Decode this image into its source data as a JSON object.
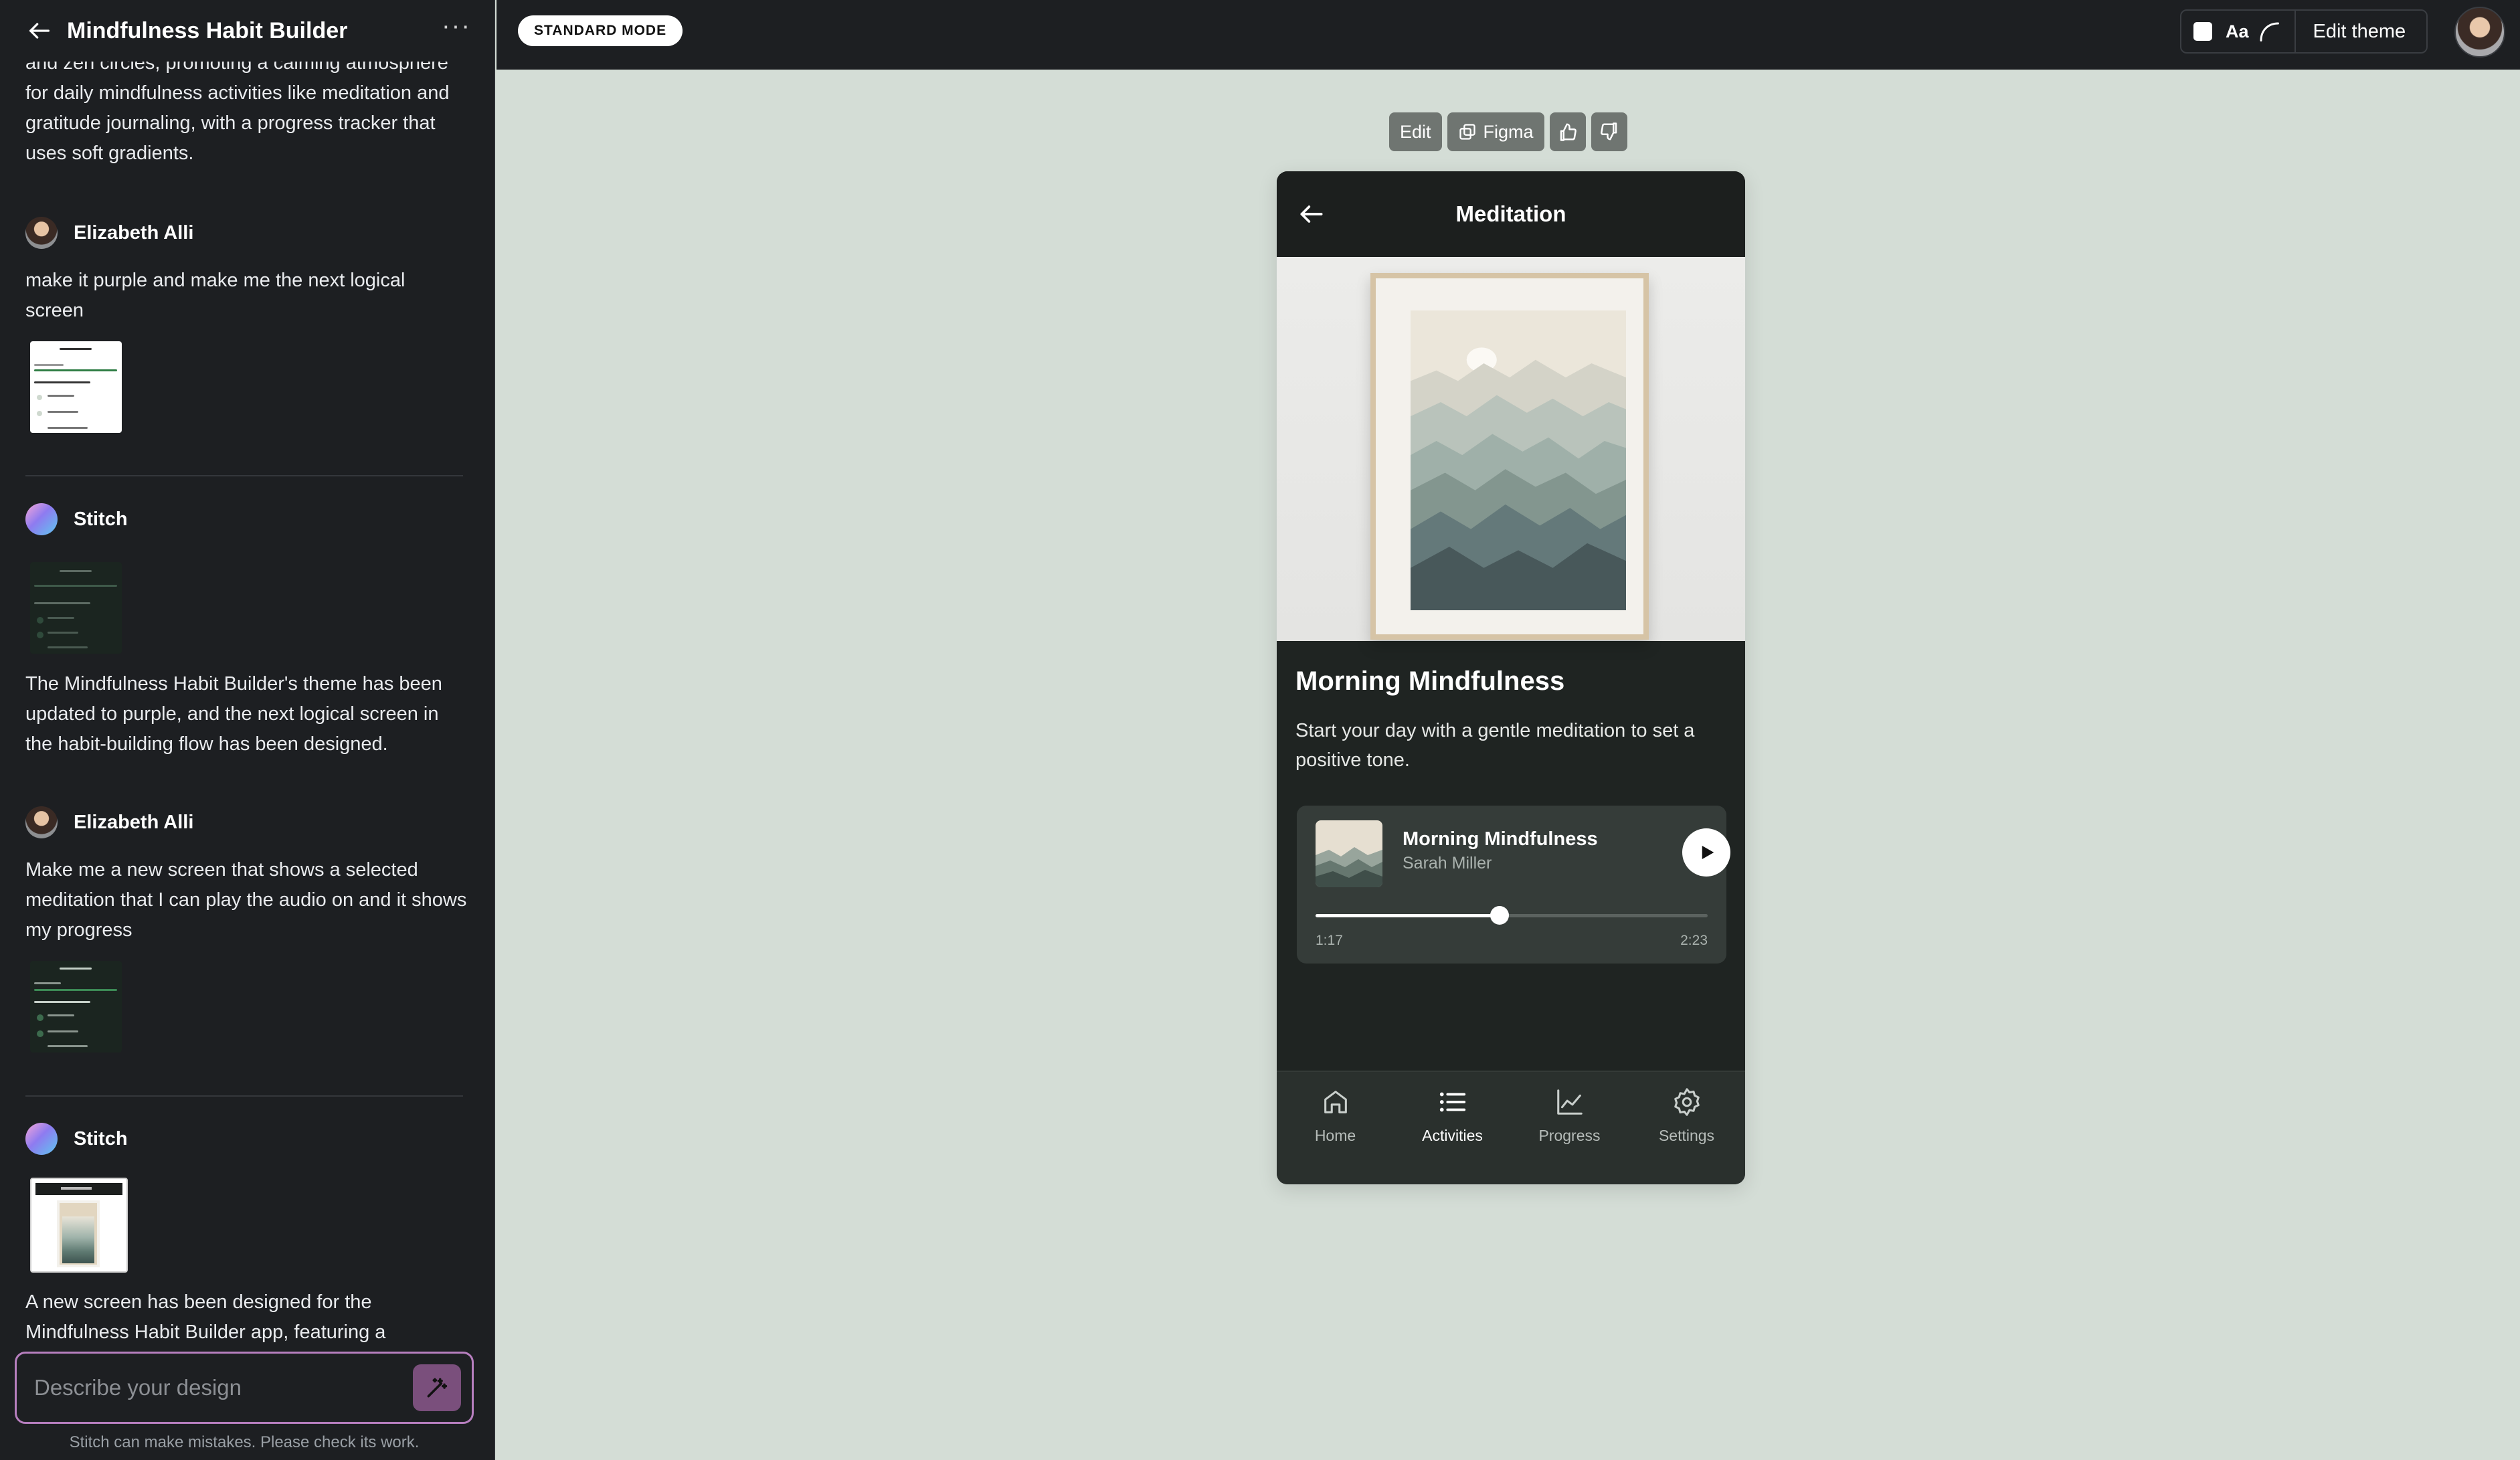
{
  "sidebar": {
    "title": "Mindfulness Habit Builder",
    "more": "···",
    "intro_text": "and zen circles, promoting a calming atmosphere for daily mindfulness activities like meditation and gratitude journaling, with a progress tracker that uses soft gradients.",
    "messages": [
      {
        "author": "Elizabeth Alli",
        "text": "make it purple and make me the next logical screen"
      },
      {
        "author": "Stitch",
        "text": "The Mindfulness Habit Builder's theme has been updated to purple, and the next logical screen in the habit-building flow has been designed."
      },
      {
        "author": "Elizabeth Alli",
        "text": "Make me a new screen that shows a selected meditation that I can play the audio on and it shows my progress"
      },
      {
        "author": "Stitch",
        "text": "A new screen has been designed for the Mindfulness Habit Builder app, featuring a"
      }
    ],
    "composer_placeholder": "Describe your design",
    "disclaimer": "Stitch can make mistakes. Please check its work."
  },
  "topbar": {
    "mode": "STANDARD MODE",
    "font_label": "Aa",
    "edit_theme": "Edit theme"
  },
  "canvas_toolbar": {
    "edit": "Edit",
    "figma": "Figma"
  },
  "phone": {
    "header_title": "Meditation",
    "session_title": "Morning Mindfulness",
    "description": "Start your day with a gentle meditation to set a positive tone.",
    "player": {
      "track": "Morning Mindfulness",
      "artist": "Sarah Miller",
      "current_time": "1:17",
      "duration": "2:23",
      "progress": 0.47
    },
    "nav": [
      {
        "label": "Home",
        "icon": "home-icon",
        "active": false
      },
      {
        "label": "Activities",
        "icon": "list-icon",
        "active": true
      },
      {
        "label": "Progress",
        "icon": "chart-icon",
        "active": false
      },
      {
        "label": "Settings",
        "icon": "gear-icon",
        "active": false
      }
    ]
  },
  "colors": {
    "canvas_bg": "#d4ddd6",
    "sidebar_bg": "#1d1f22",
    "phone_bg": "#1f2422",
    "composer_accent": "#b77fbf"
  }
}
